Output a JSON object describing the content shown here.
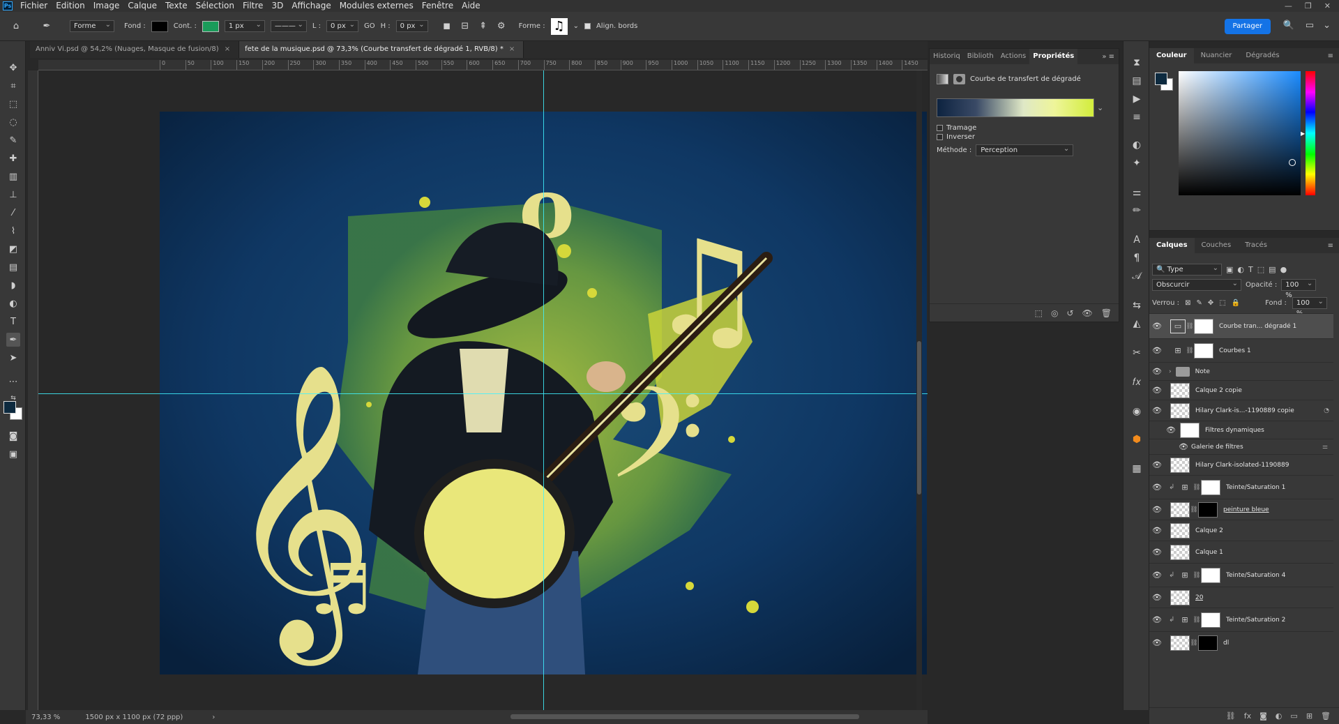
{
  "menu": {
    "logo": "Ps",
    "items": [
      "Fichier",
      "Edition",
      "Image",
      "Calque",
      "Texte",
      "Sélection",
      "Filtre",
      "3D",
      "Affichage",
      "Modules externes",
      "Fenêtre",
      "Aide"
    ]
  },
  "options": {
    "mode": "Forme",
    "fill_label": "Fond :",
    "stroke_label": "Cont. :",
    "stroke_width": "1 px",
    "w_label": "L :",
    "w_value": "0 px",
    "link_label": "GO",
    "h_label": "H :",
    "h_value": "0 px",
    "shape_label": "Forme :",
    "align_label": "Align. bords",
    "share": "Partager",
    "fill_color": "#000000",
    "stroke_color": "#1a9b5a"
  },
  "tabs": [
    {
      "label": "Anniv Vi.psd @ 54,2% (Nuages, Masque de fusion/8)",
      "close": "×"
    },
    {
      "label": "fete de la musique.psd @ 73,3% (Courbe transfert de dégradé 1, RVB/8) *",
      "close": "×"
    }
  ],
  "ruler": [
    "0",
    "50",
    "100",
    "150",
    "200",
    "250",
    "300",
    "350",
    "400",
    "450",
    "500",
    "550",
    "600",
    "650",
    "700",
    "750",
    "800",
    "850",
    "900",
    "950",
    "1000",
    "1050",
    "1100",
    "1150",
    "1200",
    "1250",
    "1300",
    "1350",
    "1400",
    "1450"
  ],
  "status": {
    "zoom": "73,33 %",
    "doc_size": "1500 px x 1100 px (72 ppp)",
    "arrow": "›"
  },
  "properties": {
    "tabs": [
      "Historiq",
      "Biblioth",
      "Actions",
      "Propriétés"
    ],
    "active_tab": "Propriétés",
    "title": "Courbe de transfert de dégradé",
    "dither_label": "Tramage",
    "reverse_label": "Inverser",
    "method_label": "Méthode :",
    "method_value": "Perception"
  },
  "color": {
    "tabs": [
      "Couleur",
      "Nuancier",
      "Dégradés"
    ],
    "fg": "#0d2a3f",
    "bg": "#ffffff"
  },
  "layers": {
    "tabs": [
      "Calques",
      "Couches",
      "Tracés"
    ],
    "filter": "Type",
    "blend": "Obscurcir",
    "opacity_label": "Opacité :",
    "opacity_value": "100 %",
    "lock_label": "Verrou :",
    "fill_label": "Fond :",
    "fill_value": "100 %",
    "items": [
      {
        "name": "Courbe tran... dégradé 1"
      },
      {
        "name": "Courbes 1"
      },
      {
        "name": "Note"
      },
      {
        "name": "Calque 2 copie"
      },
      {
        "name": "Hilary Clark-is...-1190889 copie"
      },
      {
        "name": "Filtres dynamiques"
      },
      {
        "name": "Galerie de filtres"
      },
      {
        "name": "Hilary Clark-isolated-1190889"
      },
      {
        "name": "Teinte/Saturation 1"
      },
      {
        "name": "peinture bleue"
      },
      {
        "name": "Calque 2"
      },
      {
        "name": "Calque 1"
      },
      {
        "name": "Teinte/Saturation 4"
      },
      {
        "name": "20"
      },
      {
        "name": "Teinte/Saturation 2"
      },
      {
        "name": "dl"
      }
    ]
  },
  "icons": {
    "home": "home-icon",
    "pen": "pen-tool-icon",
    "eye": "eye-icon",
    "search": "search-icon"
  }
}
